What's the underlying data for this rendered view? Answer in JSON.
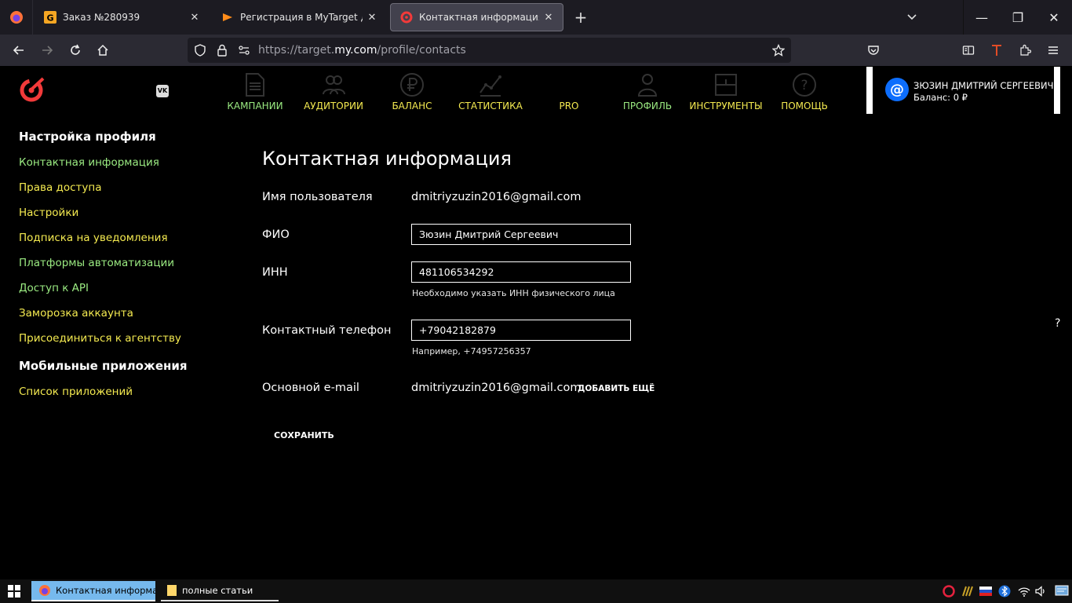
{
  "browser": {
    "tabs": [
      {
        "title": "Заказ №280939",
        "close": "✕"
      },
      {
        "title": "Регистрация в MyTarget для ф",
        "close": "✕"
      },
      {
        "title": "Контактная информация",
        "close": "✕"
      }
    ],
    "new_tab": "+",
    "url_prefix": "https://target.",
    "url_host": "my.com",
    "url_path": "/profile/contacts",
    "window_controls": {
      "minimize": "—",
      "restore": "❐",
      "close": "✕"
    }
  },
  "header": {
    "vk_badge": "VK",
    "menu": [
      {
        "label": "КАМПАНИИ",
        "icon": "document-icon",
        "color": "#9beb82"
      },
      {
        "label": "АУДИТОРИИ",
        "icon": "people-icon",
        "color": "#f4ea50"
      },
      {
        "label": "БАЛАНС",
        "icon": "ruble-icon",
        "color": "#f4ea50"
      },
      {
        "label": "СТАТИСТИКА",
        "icon": "chart-icon",
        "color": "#f4ea50"
      },
      {
        "label": "PRO",
        "icon": "",
        "color": "#f4ea50"
      },
      {
        "label": "ПРОФИЛЬ",
        "icon": "person-icon",
        "color": "#9beb82"
      },
      {
        "label": "ИНСТРУМЕНТЫ",
        "icon": "tools-icon",
        "color": "#f4ea50"
      },
      {
        "label": "ПОМОЩЬ",
        "icon": "help-icon",
        "color": "#f4ea50"
      }
    ],
    "user": {
      "name": "ЗЮЗИН ДМИТРИЙ СЕРГЕЕВИЧ",
      "balance": "Баланс: 0 ₽",
      "avatar_glyph": "@"
    }
  },
  "sidebar": {
    "section1": "Настройка профиля",
    "links1": [
      {
        "label": "Контактная информация",
        "color": "#9beb82"
      },
      {
        "label": "Права доступа",
        "color": "#f4ea50"
      },
      {
        "label": "Настройки",
        "color": "#f4ea50"
      },
      {
        "label": "Подписка на уведомления",
        "color": "#f4ea50"
      },
      {
        "label": "Платформы автоматизации",
        "color": "#9beb82"
      },
      {
        "label": "Доступ к API",
        "color": "#9beb82"
      },
      {
        "label": "Заморозка аккаунта",
        "color": "#f4ea50"
      },
      {
        "label": "Присоединиться к агентству",
        "color": "#f4ea50"
      }
    ],
    "section2": "Мобильные приложения",
    "links2": [
      {
        "label": "Список приложений",
        "color": "#f4ea50"
      }
    ]
  },
  "main": {
    "title": "Контактная информация",
    "username_label": "Имя пользователя",
    "username_value": "dmitriyzuzin2016@gmail.com",
    "fio_label": "ФИО",
    "fio_value": "Зюзин Дмитрий Сергеевич",
    "inn_label": "ИНН",
    "inn_value": "481106534292",
    "inn_hint": "Необходимо указать ИНН физического лица",
    "phone_label": "Контактный телефон",
    "phone_value": "+79042182879",
    "phone_hint": "Например, +74957256357",
    "email_label": "Основной e-mail",
    "email_value": "dmitriyzuzin2016@gmail.com",
    "add_more": "ДОБАВИТЬ ЕЩЁ",
    "save": "СОХРАНИТЬ",
    "help": "?"
  },
  "taskbar": {
    "items": [
      {
        "label": "Контактная информа..."
      },
      {
        "label": "полные статьи"
      }
    ]
  },
  "colors": {
    "yellow": "#f4ea50",
    "green": "#9beb82",
    "bg": "#000000"
  }
}
